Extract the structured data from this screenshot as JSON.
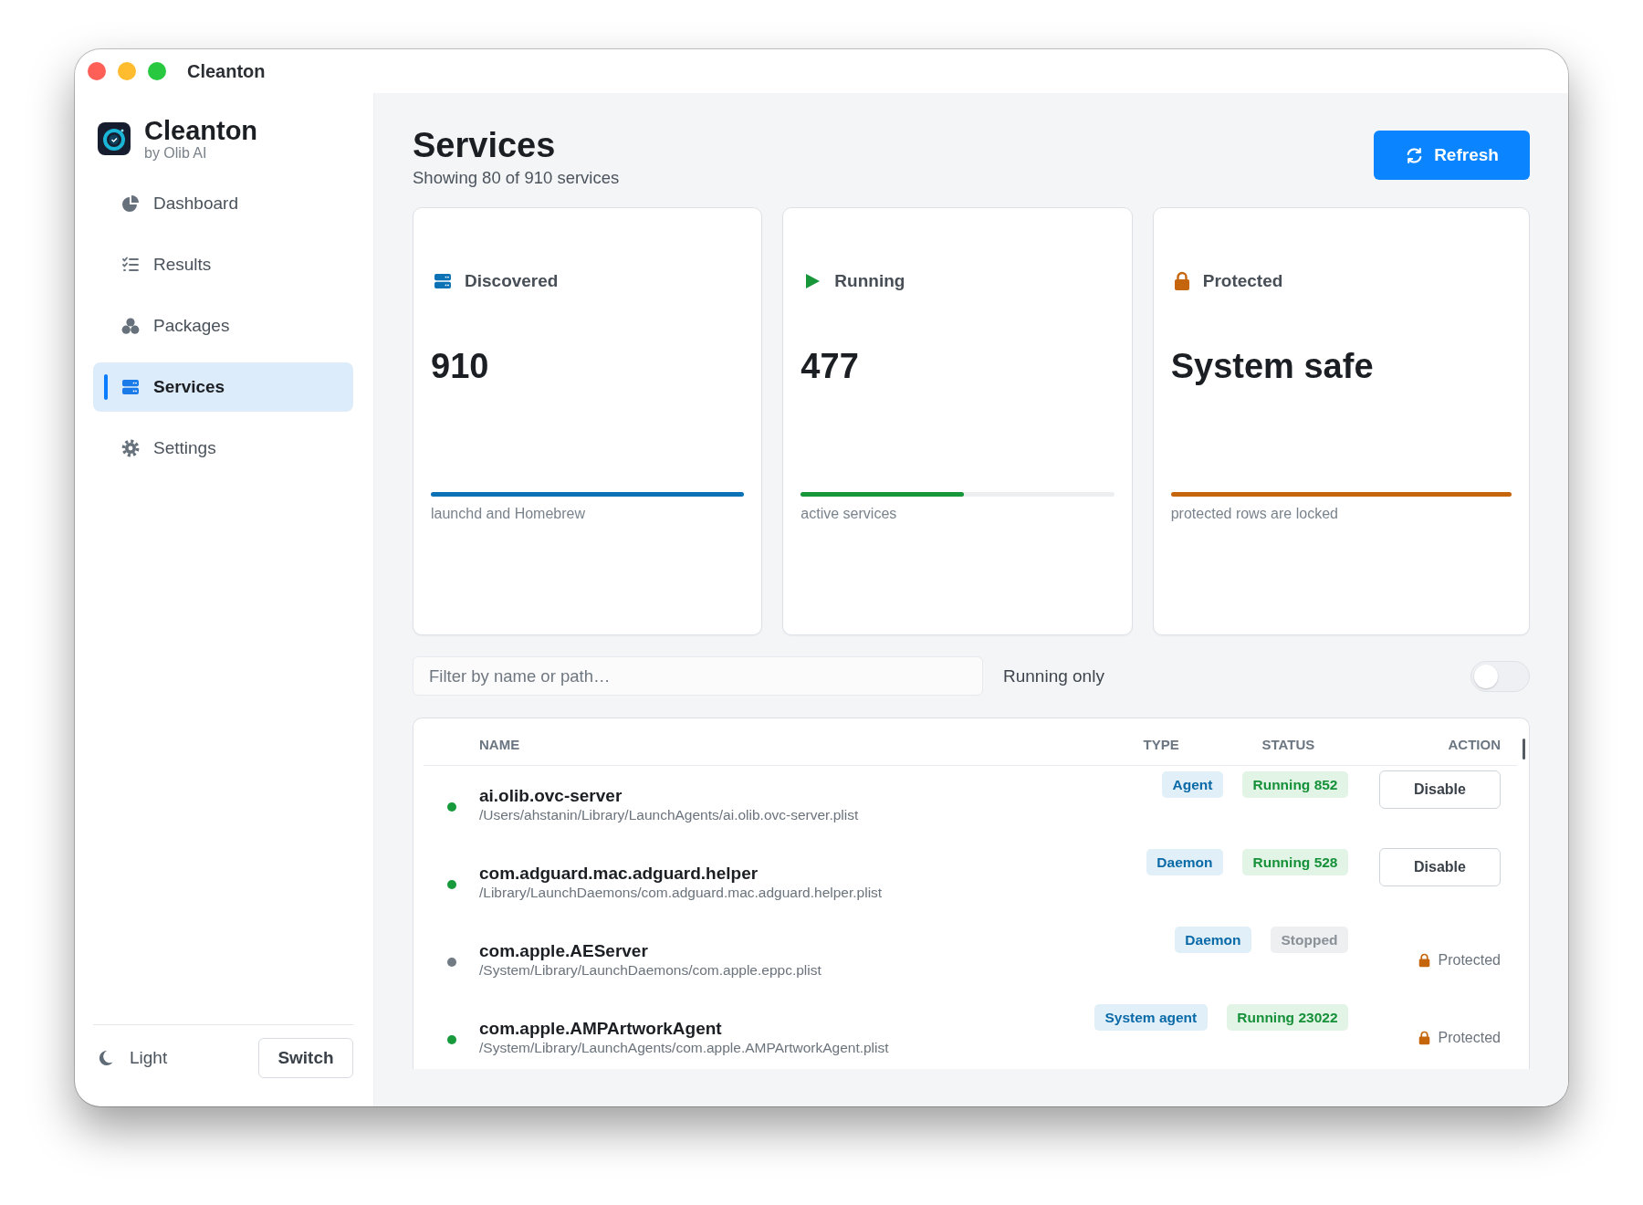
{
  "window": {
    "title": "Cleanton"
  },
  "sidebar": {
    "brand": {
      "name": "Cleanton",
      "subtitle": "by Olib AI"
    },
    "items": [
      {
        "label": "Dashboard",
        "selected": false
      },
      {
        "label": "Results",
        "selected": false
      },
      {
        "label": "Packages",
        "selected": false
      },
      {
        "label": "Services",
        "selected": true
      },
      {
        "label": "Settings",
        "selected": false
      }
    ],
    "theme": {
      "label": "Light",
      "button": "Switch"
    }
  },
  "header": {
    "title": "Services",
    "subtitle": "Showing 80 of 910 services",
    "button": "Refresh"
  },
  "cards": [
    {
      "label": "Discovered",
      "value": "910",
      "caption": "launchd and Homebrew",
      "level": 1,
      "color": "#0a72b5"
    },
    {
      "label": "Running",
      "value": "477",
      "caption": "active services",
      "level": 0.52,
      "color": "#17963a"
    },
    {
      "label": "Protected",
      "value": "System safe",
      "caption": "protected rows are locked",
      "level": 1,
      "color": "#c5660c"
    }
  ],
  "filter": {
    "placeholder": "Filter by name or path…",
    "toggle": {
      "label": "Running only",
      "on": false
    }
  },
  "table": {
    "columns": [
      "NAME",
      "TYPE",
      "STATUS",
      "ACTION"
    ],
    "rows": [
      {
        "name": "ai.olib.ovc-server",
        "path": "/Users/ahstanin/Library/LaunchAgents/ai.olib.ovc-server.plist",
        "color": "#169a3c",
        "type": "Agent",
        "status": {
          "label": "Running 852",
          "kind": "running"
        },
        "action": {
          "kind": "button",
          "label": "Disable"
        }
      },
      {
        "name": "com.adguard.mac.adguard.helper",
        "path": "/Library/LaunchDaemons/com.adguard.mac.adguard.helper.plist",
        "color": "#169a3c",
        "type": "Daemon",
        "status": {
          "label": "Running 528",
          "kind": "running"
        },
        "action": {
          "kind": "button",
          "label": "Disable"
        }
      },
      {
        "name": "com.apple.AEServer",
        "path": "/System/Library/LaunchDaemons/com.apple.eppc.plist",
        "color": "#727a84",
        "type": "Daemon",
        "status": {
          "label": "Stopped",
          "kind": "stopped"
        },
        "action": {
          "kind": "protected",
          "label": "Protected"
        }
      },
      {
        "name": "com.apple.AMPArtworkAgent",
        "path": "/System/Library/LaunchAgents/com.apple.AMPArtworkAgent.plist",
        "color": "#169a3c",
        "type": "System agent",
        "status": {
          "label": "Running 23022",
          "kind": "running"
        },
        "action": {
          "kind": "protected",
          "label": "Protected"
        }
      }
    ]
  }
}
